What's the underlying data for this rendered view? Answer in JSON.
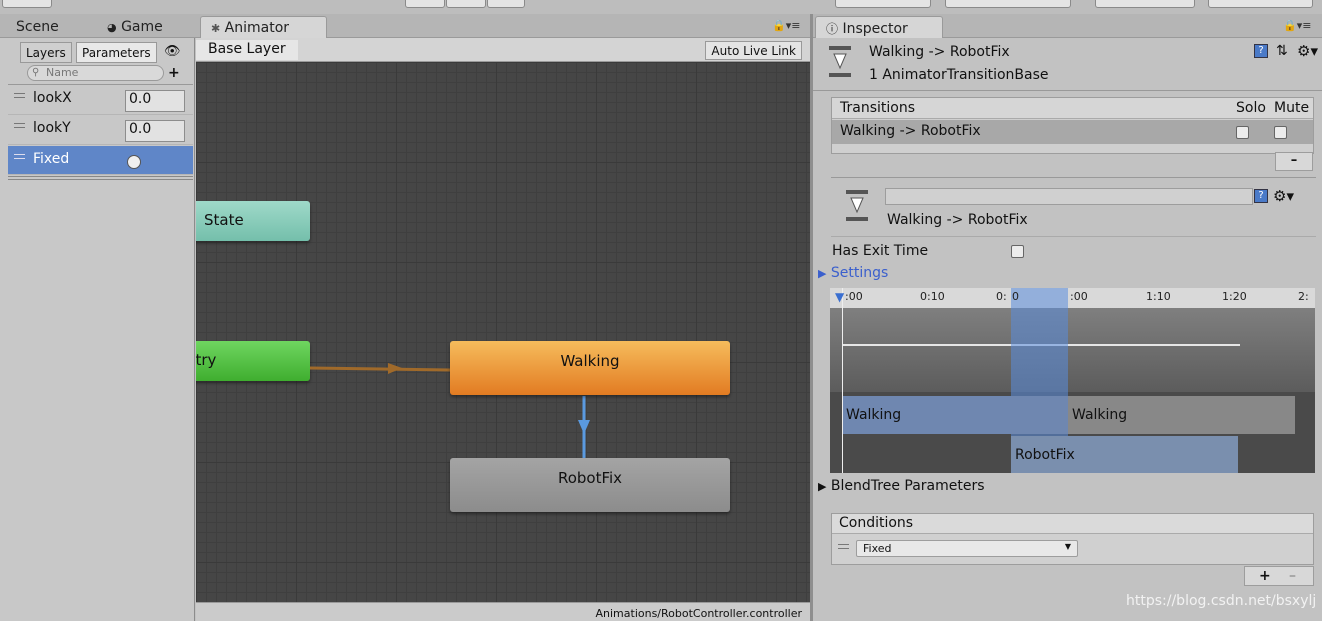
{
  "window_tabs": {
    "scene": "Scene",
    "game": "Game",
    "animator": "Animator",
    "inspector": "Inspector"
  },
  "params_panel": {
    "tabs": [
      "Layers",
      "Parameters"
    ],
    "search_placeholder": "Name",
    "params": [
      {
        "name": "lookX",
        "value": "0.0",
        "type": "float"
      },
      {
        "name": "lookY",
        "value": "0.0",
        "type": "float"
      },
      {
        "name": "Fixed",
        "type": "trigger"
      }
    ]
  },
  "graph": {
    "breadcrumb": "Base Layer",
    "auto_live_link": "Auto Live Link",
    "nodes": {
      "any_state": "State",
      "entry": "ntry",
      "walking": "Walking",
      "robotfix": "RobotFix"
    },
    "status_path": "Animations/RobotController.controller"
  },
  "inspector": {
    "title": "Walking -> RobotFix",
    "subtitle": "1 AnimatorTransitionBase",
    "transitions_header": "Transitions",
    "solo": "Solo",
    "mute": "Mute",
    "transition_item": "Walking -> RobotFix",
    "minus": "–",
    "detail_name": "Walking -> RobotFix",
    "has_exit_time": "Has Exit Time",
    "settings": "Settings",
    "timeline_ticks": [
      ":00",
      "0:10",
      "0:",
      "0",
      ":00",
      "1:10",
      "1:20",
      "2:"
    ],
    "timeline_walking_left": "Walking",
    "timeline_walking_right": "Walking",
    "timeline_robotfix": "RobotFix",
    "blendtree": "BlendTree Parameters",
    "conditions_header": "Conditions",
    "condition_param": "Fixed",
    "plus": "+",
    "minus2": "–"
  },
  "watermark": "https://blog.csdn.net/bsxylj",
  "colors": {
    "selected": "#5f86c8",
    "walking": "#e8892a",
    "anystate": "#7fc7b4",
    "entry": "#4fbf3f",
    "robotfix": "#8e8e8e",
    "transition": "#5a9ae0"
  }
}
